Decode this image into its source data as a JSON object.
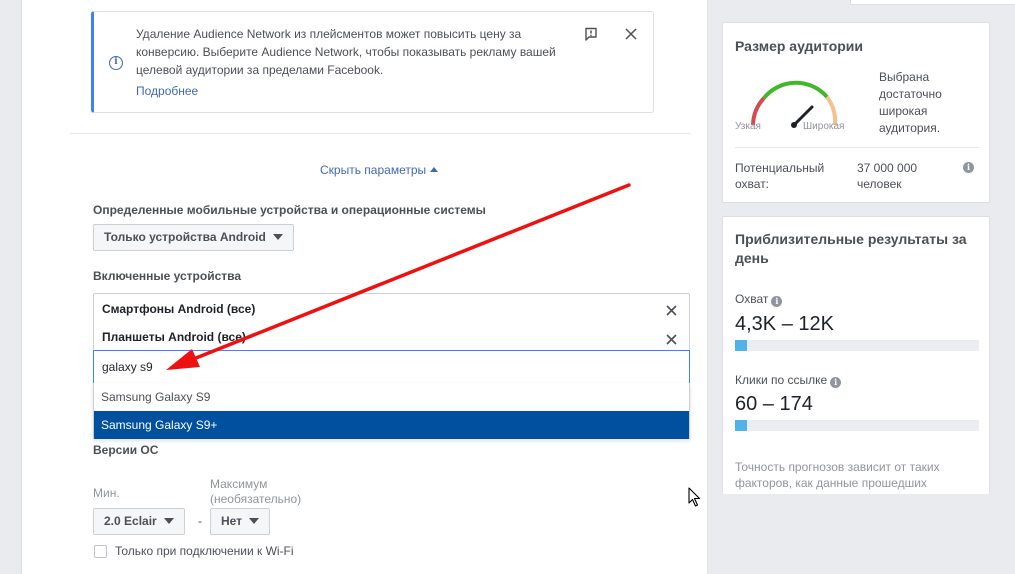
{
  "notice": {
    "text": "Удаление Audience Network из плейсментов может повысить цену за конверсию. Выберите Audience Network, чтобы показывать рекламу вашей целевой аудитории за пределами Facebook.",
    "link": "Подробнее",
    "info_icon": "i",
    "flag_icon": "flag-icon",
    "close_icon": "close-icon"
  },
  "params": {
    "hide_label": "Скрыть параметры"
  },
  "mobile_os": {
    "label": "Определенные мобильные устройства и операционные системы",
    "selected": "Только устройства Android"
  },
  "included_devices": {
    "label": "Включенные устройства",
    "tags": [
      "Смартфоны Android (все)",
      "Планшеты Android (все)"
    ],
    "search_value": "galaxy s9",
    "suggestions": [
      "Samsung Galaxy S9",
      "Samsung Galaxy S9+"
    ],
    "selected_suggestion_index": 1
  },
  "os_versions": {
    "label": "Версии ОС",
    "min_label": "Мин.",
    "max_label_line1": "Максимум",
    "max_label_line2": "(необязательно)",
    "min_value": "2.0 Eclair",
    "separator": "-",
    "max_value": "Нет"
  },
  "wifi": {
    "label": "Только при подключении к Wi-Fi",
    "checked": false
  },
  "audience_size": {
    "title": "Размер аудитории",
    "narrow_label": "Узкая",
    "wide_label": "Широкая",
    "status": "Выбрана достаточно широкая аудитория.",
    "potential_reach_label": "Потенциальный охват:",
    "potential_reach_value": "37 000 000 человек",
    "info_icon": "i"
  },
  "daily_results": {
    "title": "Приблизительные результаты за день",
    "reach_label": "Охват",
    "reach_value": "4,3K – 12K",
    "reach_fill": 0.05,
    "clicks_label": "Клики по ссылке",
    "clicks_value": "60 – 174",
    "clicks_fill": 0.05,
    "info_icon": "i",
    "footnote": "Точность прогнозов зависит от таких факторов, как данные прошедших"
  },
  "colors": {
    "link": "#4267b2",
    "accent_border": "#4080ff",
    "selected_row": "#0050a0",
    "bar_fill": "#4fb3e8",
    "annotation_arrow": "#ee1111"
  }
}
